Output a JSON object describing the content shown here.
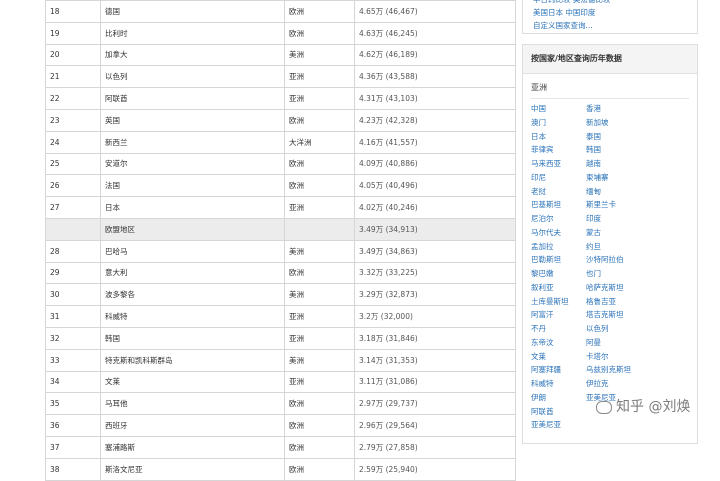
{
  "table": {
    "rows": [
      {
        "rank": "18",
        "country": "德国",
        "continent": "欧洲",
        "value": "4.65万 (46,467)"
      },
      {
        "rank": "19",
        "country": "比利时",
        "continent": "欧洲",
        "value": "4.63万 (46,245)"
      },
      {
        "rank": "20",
        "country": "加拿大",
        "continent": "美洲",
        "value": "4.62万 (46,189)"
      },
      {
        "rank": "21",
        "country": "以色列",
        "continent": "亚洲",
        "value": "4.36万 (43,588)"
      },
      {
        "rank": "22",
        "country": "阿联酋",
        "continent": "亚洲",
        "value": "4.31万 (43,103)"
      },
      {
        "rank": "23",
        "country": "英国",
        "continent": "欧洲",
        "value": "4.23万 (42,328)"
      },
      {
        "rank": "24",
        "country": "新西兰",
        "continent": "大洋洲",
        "value": "4.16万 (41,557)"
      },
      {
        "rank": "25",
        "country": "安道尔",
        "continent": "欧洲",
        "value": "4.09万 (40,886)"
      },
      {
        "rank": "26",
        "country": "法国",
        "continent": "欧洲",
        "value": "4.05万 (40,496)"
      },
      {
        "rank": "27",
        "country": "日本",
        "continent": "亚洲",
        "value": "4.02万 (40,246)"
      },
      {
        "rank": "",
        "country": "欧盟地区",
        "continent": "",
        "value": "3.49万 (34,913)",
        "region": true
      },
      {
        "rank": "28",
        "country": "巴哈马",
        "continent": "美洲",
        "value": "3.49万 (34,863)"
      },
      {
        "rank": "29",
        "country": "意大利",
        "continent": "欧洲",
        "value": "3.32万 (33,225)"
      },
      {
        "rank": "30",
        "country": "波多黎各",
        "continent": "美洲",
        "value": "3.29万 (32,873)"
      },
      {
        "rank": "31",
        "country": "科威特",
        "continent": "亚洲",
        "value": "3.2万 (32,000)"
      },
      {
        "rank": "32",
        "country": "韩国",
        "continent": "亚洲",
        "value": "3.18万 (31,846)"
      },
      {
        "rank": "33",
        "country": "特克斯和凯科斯群岛",
        "continent": "美洲",
        "value": "3.14万 (31,353)"
      },
      {
        "rank": "34",
        "country": "文莱",
        "continent": "亚洲",
        "value": "3.11万 (31,086)"
      },
      {
        "rank": "35",
        "country": "马耳他",
        "continent": "欧洲",
        "value": "2.97万 (29,737)"
      },
      {
        "rank": "36",
        "country": "西班牙",
        "continent": "欧洲",
        "value": "2.96万 (29,564)"
      },
      {
        "rank": "37",
        "country": "塞浦路斯",
        "continent": "欧洲",
        "value": "2.79万 (27,858)"
      },
      {
        "rank": "38",
        "country": "斯洛文尼亚",
        "continent": "欧洲",
        "value": "2.59万 (25,940)"
      }
    ]
  },
  "sidebar_top": {
    "links": [
      "中日韩比较  英法德比较",
      "美国日本 中国印度",
      "自定义国家查询..."
    ]
  },
  "panel": {
    "title": "按国家/地区查询历年数据",
    "region": "亚洲",
    "countries": [
      [
        "中国",
        "香港"
      ],
      [
        "澳门",
        "新加坡"
      ],
      [
        "日本",
        "泰国"
      ],
      [
        "菲律宾",
        "韩国"
      ],
      [
        "马来西亚",
        "越南"
      ],
      [
        "印尼",
        "柬埔寨"
      ],
      [
        "老挝",
        "缅甸"
      ],
      [
        "巴基斯坦",
        "斯里兰卡"
      ],
      [
        "尼泊尔",
        "印度"
      ],
      [
        "马尔代夫",
        "蒙古"
      ],
      [
        "孟加拉",
        "约旦"
      ],
      [
        "巴勒斯坦",
        "沙特阿拉伯"
      ],
      [
        "黎巴嫩",
        "也门"
      ],
      [
        "叙利亚",
        "哈萨克斯坦"
      ],
      [
        "土库曼斯坦",
        "格鲁吉亚"
      ],
      [
        "阿富汗",
        "塔吉克斯坦"
      ],
      [
        "不丹",
        "以色列"
      ],
      [
        "东帝汶",
        "阿曼"
      ],
      [
        "文莱",
        "卡塔尔"
      ],
      [
        "阿塞拜疆",
        "乌兹别克斯坦"
      ],
      [
        "科威特",
        "伊拉克"
      ],
      [
        "伊朗",
        "亚美尼亚"
      ],
      [
        "阿联酋",
        ""
      ],
      [
        "亚美尼亚",
        ""
      ]
    ]
  },
  "watermark": "知乎 @刘焕"
}
